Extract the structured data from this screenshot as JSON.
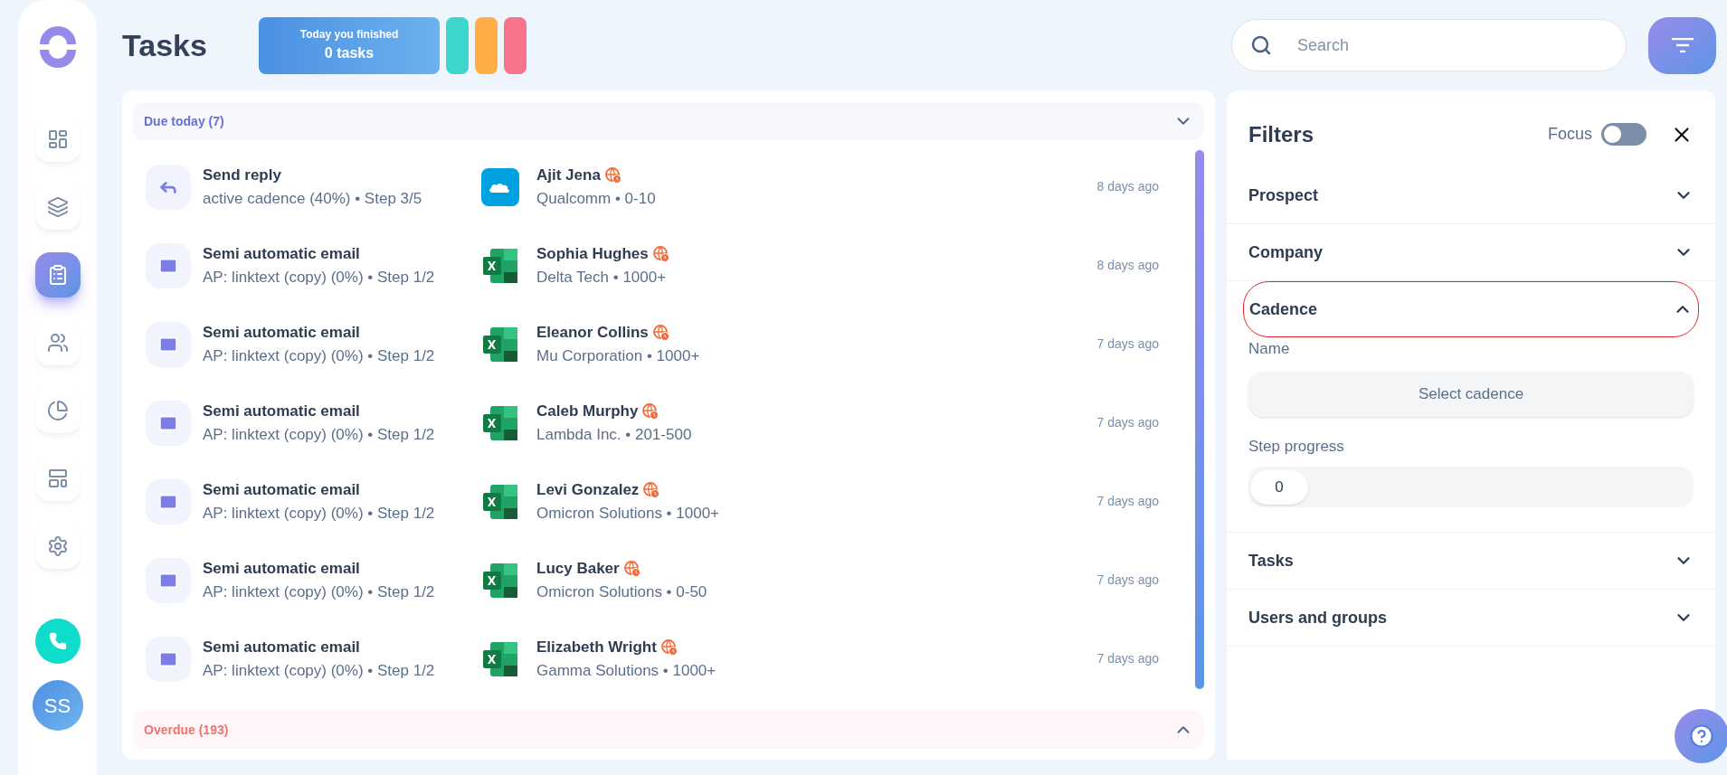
{
  "sidebar": {
    "items": [
      {
        "selected": false
      },
      {
        "selected": false
      },
      {
        "selected": true
      },
      {
        "selected": false
      },
      {
        "selected": false
      },
      {
        "selected": false
      },
      {
        "selected": false
      }
    ],
    "avatar": "SS"
  },
  "header": {
    "title": "Tasks",
    "finished": {
      "label": "Today you finished",
      "count": "0 tasks"
    },
    "pills": [
      {
        "color": "#3dd6cf"
      },
      {
        "color": "#ffae45"
      },
      {
        "color": "#f8738c"
      }
    ],
    "search": {
      "placeholder": "Search"
    }
  },
  "tasks": {
    "due_today": {
      "label": "Due today (7)",
      "expanded": true
    },
    "rows": [
      {
        "kind": "reply",
        "title": "Send reply",
        "subtitle": "active cadence (40%) • Step 3/5",
        "source": {
          "kind": "cloud"
        },
        "name": "Ajit Jena",
        "company": "Qualcomm • 0-10",
        "time": "8 days ago"
      },
      {
        "kind": "email",
        "title": "Semi automatic email",
        "subtitle": "AP: linktext (copy) (0%) • Step 1/2",
        "source": {
          "kind": "sheet"
        },
        "name": "Sophia Hughes",
        "company": "Delta Tech • 1000+",
        "time": "8 days ago"
      },
      {
        "kind": "email",
        "title": "Semi automatic email",
        "subtitle": "AP: linktext (copy) (0%) • Step 1/2",
        "source": {
          "kind": "sheet"
        },
        "name": "Eleanor Collins",
        "company": "Mu Corporation • 1000+",
        "time": "7 days ago"
      },
      {
        "kind": "email",
        "title": "Semi automatic email",
        "subtitle": "AP: linktext (copy) (0%) • Step 1/2",
        "source": {
          "kind": "sheet"
        },
        "name": "Caleb Murphy",
        "company": "Lambda Inc. • 201-500",
        "time": "7 days ago"
      },
      {
        "kind": "email",
        "title": "Semi automatic email",
        "subtitle": "AP: linktext (copy) (0%) • Step 1/2",
        "source": {
          "kind": "sheet"
        },
        "name": "Levi Gonzalez",
        "company": "Omicron Solutions • 1000+",
        "time": "7 days ago"
      },
      {
        "kind": "email",
        "title": "Semi automatic email",
        "subtitle": "AP: linktext (copy) (0%) • Step 1/2",
        "source": {
          "kind": "sheet"
        },
        "name": "Lucy Baker",
        "company": "Omicron Solutions • 0-50",
        "time": "7 days ago"
      },
      {
        "kind": "email",
        "title": "Semi automatic email",
        "subtitle": "AP: linktext (copy) (0%) • Step 1/2",
        "source": {
          "kind": "sheet"
        },
        "name": "Elizabeth Wright",
        "company": "Gamma Solutions • 1000+",
        "time": "7 days ago"
      }
    ],
    "overdue": {
      "label": "Overdue (193)",
      "expanded": false
    }
  },
  "filters": {
    "title": "Filters",
    "focus": {
      "label": "Focus",
      "on": false
    },
    "sections": [
      {
        "label": "Prospect",
        "expanded": false,
        "highlighted": false
      },
      {
        "label": "Company",
        "expanded": false,
        "highlighted": false
      },
      {
        "label": "Cadence",
        "expanded": true,
        "highlighted": true,
        "name_label": "Name",
        "name_placeholder": "Select cadence",
        "progress_label": "Step progress",
        "progress_value": "0",
        "level": 0
      },
      {
        "label": "Tasks",
        "expanded": false,
        "highlighted": false
      },
      {
        "label": "Users and groups",
        "expanded": false,
        "highlighted": false
      }
    ]
  }
}
